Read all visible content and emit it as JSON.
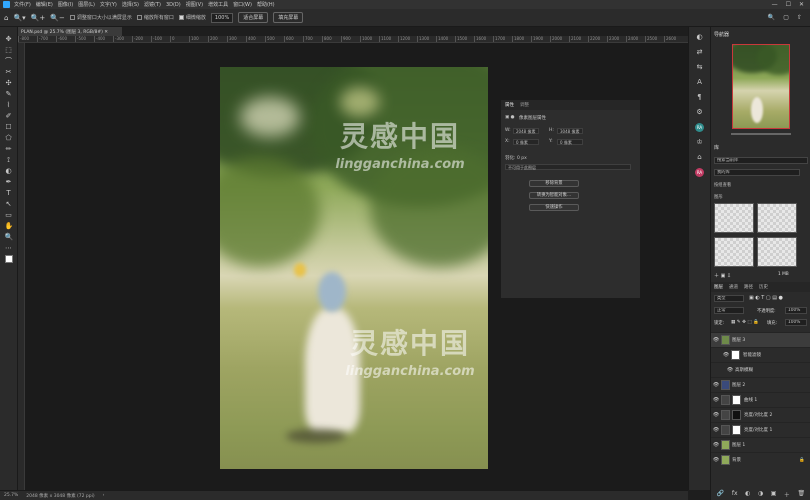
{
  "menu": {
    "items": [
      "文件(F)",
      "编辑(E)",
      "图像(I)",
      "图层(L)",
      "文字(Y)",
      "选择(S)",
      "滤镜(T)",
      "3D(D)",
      "视图(V)",
      "增效工具",
      "窗口(W)",
      "帮助(H)"
    ],
    "window_controls": [
      "—",
      "☐",
      "✕"
    ]
  },
  "options": {
    "zoom_in": "🔍+",
    "zoom_out": "🔍−",
    "resize_windows": "调整窗口大小以满屏显示",
    "zoom_all": "缩放所有窗口",
    "scrubby_zoom": "细微缩放",
    "zoom_value": "100%",
    "fit_screen": "适合屏幕",
    "fill_screen": "填充屏幕",
    "right_icons": [
      "🔍",
      "▢",
      "⇧"
    ]
  },
  "document": {
    "tab_title": "PLAN.psd @ 25.7% (图层 3, RGB/8#)",
    "ruler_ticks": [
      "-800",
      "-700",
      "-600",
      "-500",
      "-400",
      "-300",
      "-200",
      "-100",
      "0",
      "100",
      "200",
      "300",
      "400",
      "500",
      "600",
      "700",
      "800",
      "900",
      "1000",
      "1100",
      "1200",
      "1300",
      "1400",
      "1500",
      "1600",
      "1700",
      "1800",
      "1900",
      "2000",
      "2100",
      "2200",
      "2300",
      "2400",
      "2500",
      "2600"
    ]
  },
  "status": {
    "zoom": "25.7%",
    "doc_info": "2048 像素 x 3048 像素 (72 ppi)",
    "arrow": "›"
  },
  "properties": {
    "tab_active": "属性",
    "tab_other": "调整",
    "section": "像素图层属性",
    "w_label": "W:",
    "w_value": "2048 像素",
    "h_label": "H:",
    "h_value": "3048 像素",
    "x_label": "X:",
    "x_value": "0 像素",
    "y_label": "Y:",
    "y_value": "0 像素",
    "feather_label": "羽化: 0 px",
    "feather_placeholder": "不可用于此图层",
    "btn_remove_bg": "移除背景",
    "btn_convert": "转换为智能对象...",
    "btn_quick": "快速操作"
  },
  "right_panel": {
    "navigator_title": "导航器",
    "libraries_title": "库",
    "library_search": "搜索当前库",
    "library_name": "我的库",
    "library_view": "按组查看",
    "library_group": "图形",
    "library_size": "1 MB",
    "layers_tabs": [
      "图层",
      "通道",
      "路径",
      "历史"
    ],
    "kind_filter": "类型",
    "blend_mode": "正常",
    "opacity_label": "不透明度:",
    "opacity_value": "100%",
    "lock_label": "锁定:",
    "fill_label": "填充:",
    "fill_value": "100%",
    "layers": [
      {
        "name": "图层 3",
        "color": "#6e8a4a",
        "mask": false
      },
      {
        "name": "智能滤镜",
        "color": "#ffffff",
        "mask": false
      },
      {
        "name": "高斯模糊",
        "color": "",
        "mask": false
      },
      {
        "name": "图层 2",
        "color": "#3a4a7a",
        "mask": false
      },
      {
        "name": "曲线 1",
        "color": "#444444",
        "mask": true
      },
      {
        "name": "亮度/对比度 2",
        "color": "#444444",
        "mask": true
      },
      {
        "name": "亮度/对比度 1",
        "color": "#444444",
        "mask": true
      },
      {
        "name": "图层 1",
        "color": "#8fa95a",
        "mask": false
      },
      {
        "name": "背景",
        "color": "#8fa95a",
        "mask": false
      }
    ],
    "bottom_icons": [
      "🔗",
      "fx",
      "◐",
      "◑",
      "▣",
      "＋",
      "🗑"
    ]
  },
  "icon_column": [
    "◐",
    "⇄",
    "⇆",
    "A",
    "¶",
    "⚙",
    "RA",
    "♔",
    "⌂",
    "RA"
  ],
  "tools": [
    "✥",
    "⬚",
    "⌒",
    "✂",
    "✣",
    "✎",
    "⌇",
    "✐",
    "☐",
    "⬠",
    "✏",
    "⟟",
    "◐",
    "✒",
    "T",
    "↖",
    "▭",
    "✋",
    "🔍",
    "⋯"
  ],
  "watermark": {
    "text_cn": "灵感中国",
    "text_en": "lingganchina.com"
  },
  "colors": {
    "accent": "#31a8ff",
    "nav_frame": "#c8393b",
    "badge_teal": "#2f8c8c",
    "badge_pink": "#c13b63"
  }
}
